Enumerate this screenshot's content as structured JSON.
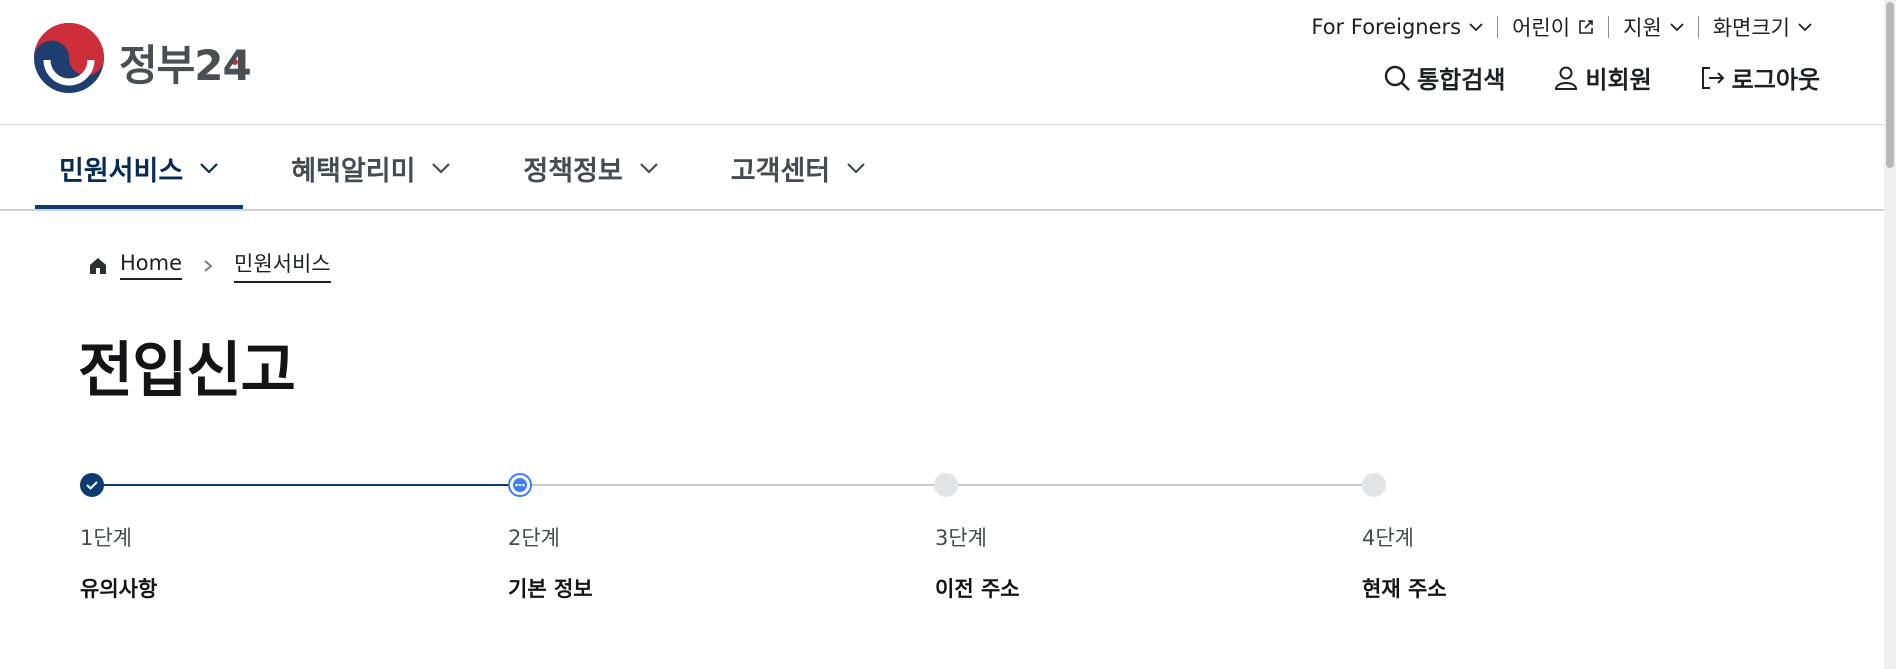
{
  "header": {
    "logo_text": "정부24",
    "utility_links": [
      {
        "label": "For Foreigners",
        "icon": "chevron-down-icon"
      },
      {
        "label": "어린이",
        "icon": "external-link-icon"
      },
      {
        "label": "지원",
        "icon": "chevron-down-icon"
      },
      {
        "label": "화면크기",
        "icon": "chevron-down-icon"
      }
    ],
    "actions": [
      {
        "label": "통합검색",
        "icon": "search-icon"
      },
      {
        "label": "비회원",
        "icon": "user-icon"
      },
      {
        "label": "로그아웃",
        "icon": "logout-icon"
      }
    ]
  },
  "nav": {
    "items": [
      {
        "label": "민원서비스",
        "active": true
      },
      {
        "label": "혜택알리미",
        "active": false
      },
      {
        "label": "정책정보",
        "active": false
      },
      {
        "label": "고객센터",
        "active": false
      }
    ]
  },
  "breadcrumb": {
    "home": "Home",
    "current": "민원서비스"
  },
  "page": {
    "title": "전입신고"
  },
  "steps": [
    {
      "number": "1단계",
      "name": "유의사항",
      "status": "done"
    },
    {
      "number": "2단계",
      "name": "기본 정보",
      "status": "current"
    },
    {
      "number": "3단계",
      "name": "이전 주소",
      "status": "todo"
    },
    {
      "number": "4단계",
      "name": "현재 주소",
      "status": "todo"
    }
  ],
  "colors": {
    "primary": "#0b3b73",
    "current_step": "#3d7ef3",
    "todo_step": "#e2e4e6",
    "logo_blue": "#1f3e70",
    "logo_red": "#cd2e3a"
  }
}
